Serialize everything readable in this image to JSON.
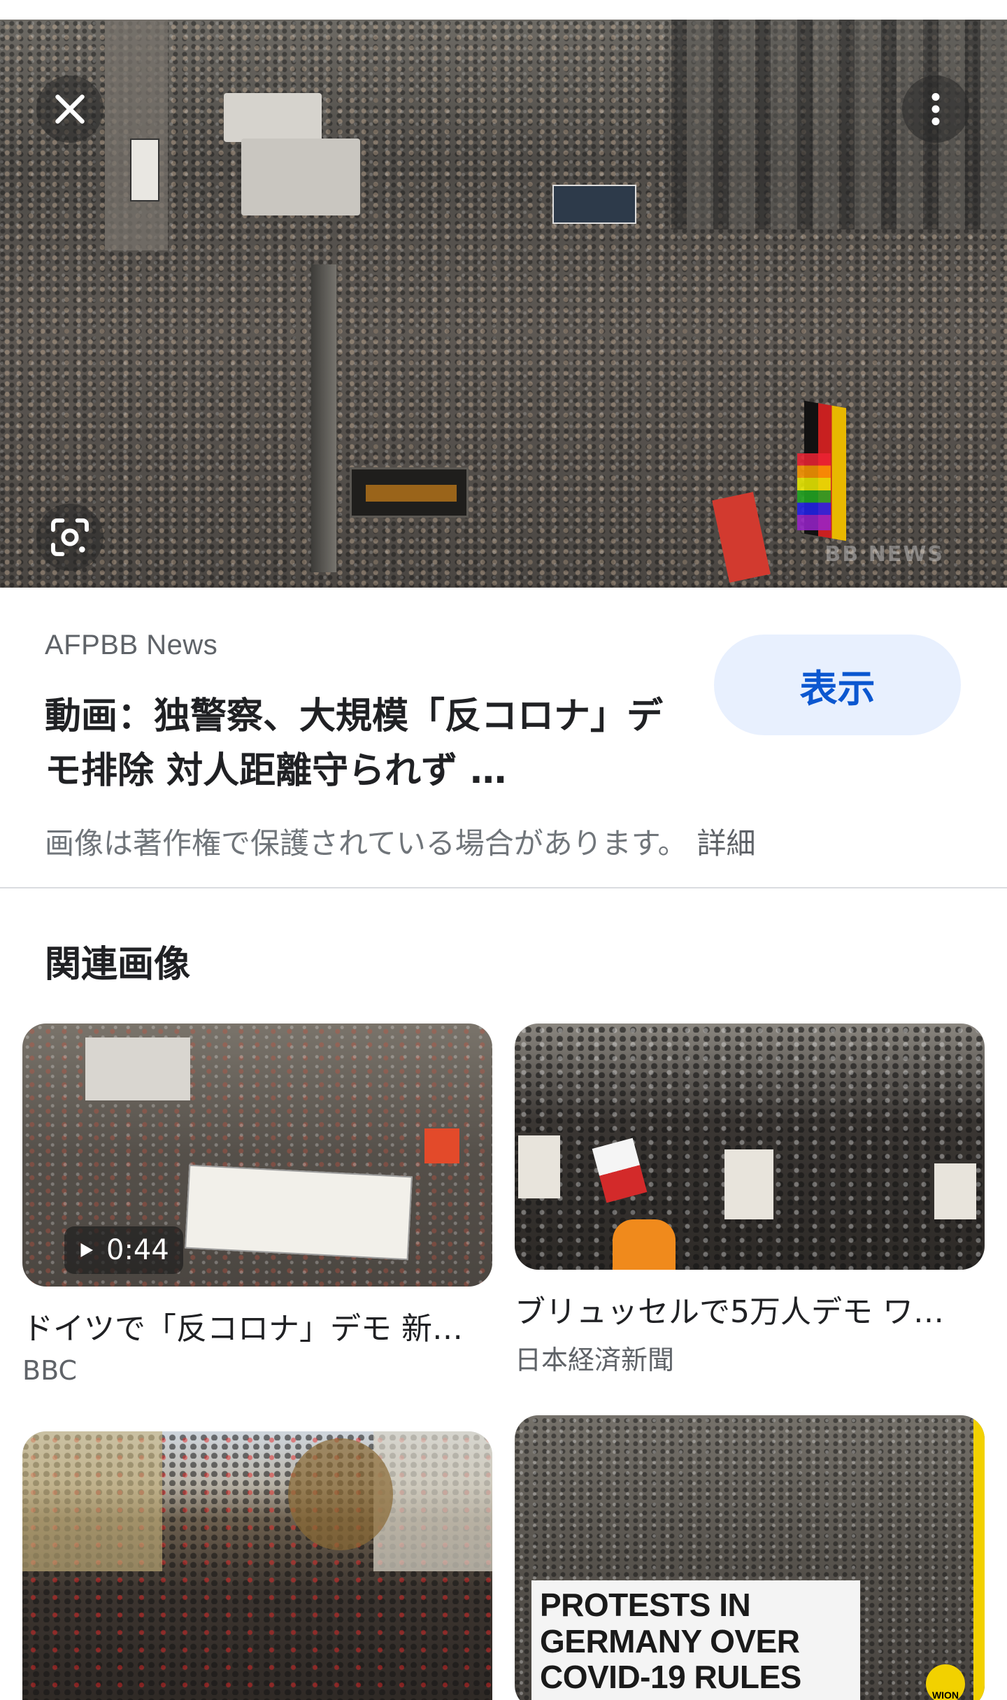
{
  "hero": {
    "watermark": "BB NEWS"
  },
  "result": {
    "source": "AFPBB News",
    "title": "動画：独警察、大規模「反コロナ」デモ排除 対人距離守られず …",
    "view_label": "表示",
    "copyright": "画像は著作権で保護されている場合があります。",
    "detail_link": "詳細"
  },
  "related": {
    "heading": "関連画像",
    "items": [
      {
        "title": "ドイツで「反コロナ」デモ 新…",
        "source": "BBC",
        "duration": "0:44"
      },
      {
        "title": "ブリュッセルで5万人デモ ワ…",
        "source": "日本経済新聞"
      },
      {
        "title": "",
        "source": ""
      },
      {
        "title": "",
        "source": "",
        "headline": "PROTESTS IN GERMANY OVER COVID-19 RULES",
        "logo": "WION"
      }
    ]
  },
  "colors": {
    "accent": "#0b57d0",
    "button_bg": "#e8f0fe",
    "divider": "#dadce0"
  },
  "icons": [
    "close-icon",
    "more-vert-icon",
    "lens-icon",
    "play-icon"
  ]
}
